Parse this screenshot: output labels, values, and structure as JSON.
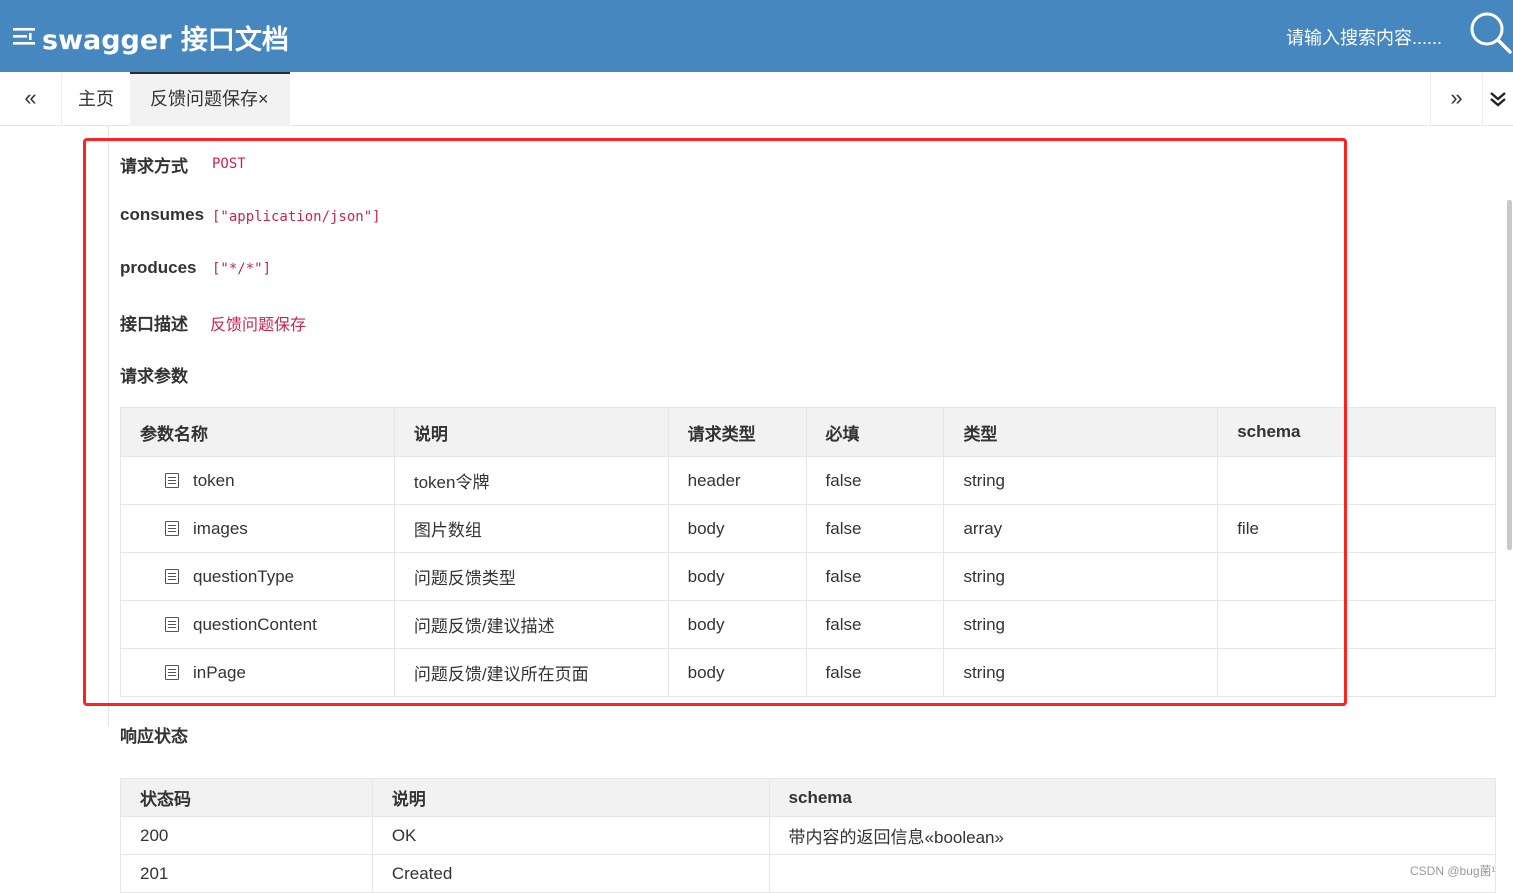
{
  "header": {
    "brand": "swagger 接口文档",
    "search_placeholder": "请输入搜索内容......"
  },
  "tabs": {
    "prev": "«",
    "home": "主页",
    "active": "反馈问题保存",
    "close": "×",
    "next": "»"
  },
  "info": {
    "method_label": "请求方式",
    "method_value": "POST",
    "consumes_label": "consumes",
    "consumes_value": "[\"application/json\"]",
    "produces_label": "produces",
    "produces_value": "[\"*/*\"]",
    "desc_label": "接口描述",
    "desc_value": "反馈问题保存",
    "params_label": "请求参数"
  },
  "params_table": {
    "headers": [
      "参数名称",
      "说明",
      "请求类型",
      "必填",
      "类型",
      "schema"
    ],
    "rows": [
      {
        "name": "token",
        "desc": "token令牌",
        "in": "header",
        "required": "false",
        "type": "string",
        "schema": ""
      },
      {
        "name": "images",
        "desc": "图片数组",
        "in": "body",
        "required": "false",
        "type": "array",
        "schema": "file"
      },
      {
        "name": "questionType",
        "desc": "问题反馈类型",
        "in": "body",
        "required": "false",
        "type": "string",
        "schema": ""
      },
      {
        "name": "questionContent",
        "desc": "问题反馈/建议描述",
        "in": "body",
        "required": "false",
        "type": "string",
        "schema": ""
      },
      {
        "name": "inPage",
        "desc": "问题反馈/建议所在页面",
        "in": "body",
        "required": "false",
        "type": "string",
        "schema": ""
      }
    ]
  },
  "response": {
    "label": "响应状态",
    "headers": [
      "状态码",
      "说明",
      "schema"
    ],
    "rows": [
      {
        "code": "200",
        "desc": "OK",
        "schema": "带内容的返回信息«boolean»"
      },
      {
        "code": "201",
        "desc": "Created",
        "schema": ""
      }
    ]
  },
  "watermark": "CSDN @bug菌¹",
  "colors": {
    "header_bg": "#4787bf",
    "method": "#c7254e",
    "header_in": "#f7941d",
    "body_in": "#1e6fcf",
    "highlight": "#ff2222"
  }
}
